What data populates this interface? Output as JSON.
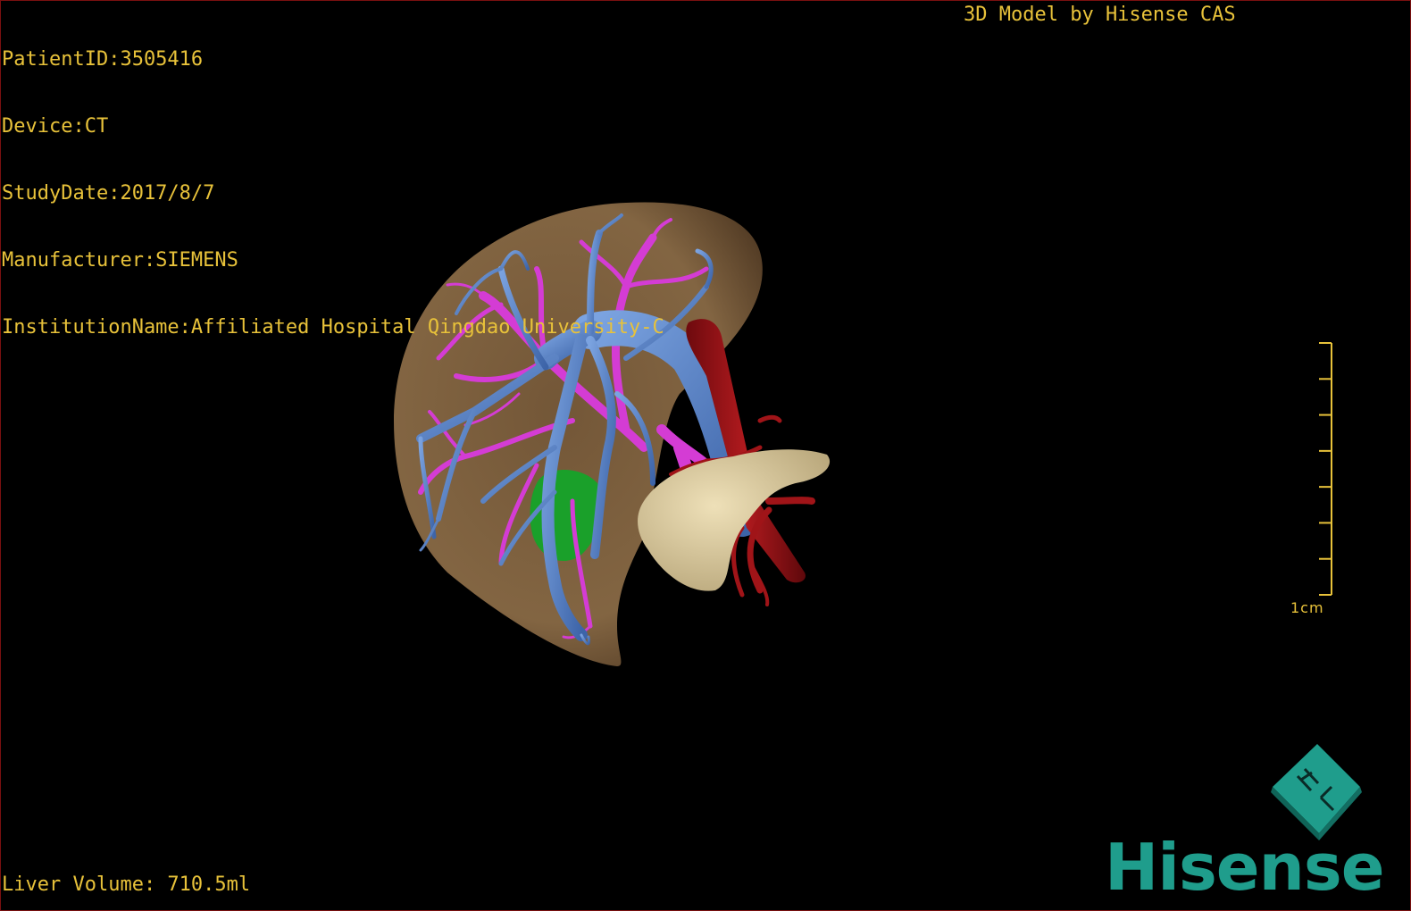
{
  "patient_info": {
    "patient_id": "PatientID:3505416",
    "device": "Device:CT",
    "study_date": "StudyDate:2017/8/7",
    "manufacturer": "Manufacturer:SIEMENS",
    "institution": "InstitutionName:Affiliated Hospital Qingdao University-C"
  },
  "credit": "3D Model by Hisense CAS",
  "liver_volume": "Liver Volume: 710.5ml",
  "scale_bar": {
    "label": "1cm",
    "ticks": 8
  },
  "brand": {
    "name": "Hisense",
    "color": "#1f9d8c"
  },
  "colors": {
    "overlay_text": "#e8c23a",
    "background": "#000000",
    "liver": "#8a6a45",
    "portal_vein": "#5b86c8",
    "hepatic_vein": "#d43cd4",
    "artery": "#9e1216",
    "pancreas": "#d8c89a",
    "gallbladder": "#1aa02a"
  },
  "structures": [
    "liver-surface",
    "portal-vein",
    "hepatic-vein",
    "aorta",
    "hepatic-artery",
    "pancreas",
    "gallbladder"
  ]
}
